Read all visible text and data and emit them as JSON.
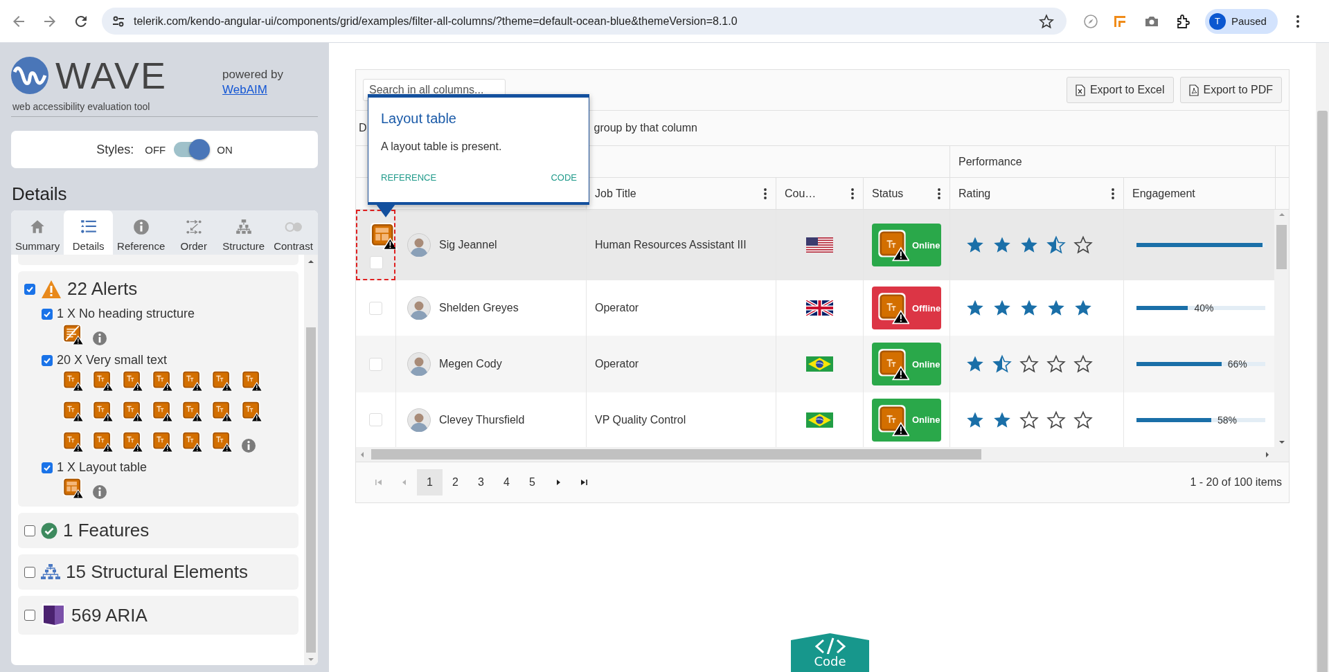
{
  "browser": {
    "url": "telerik.com/kendo-angular-ui/components/grid/examples/filter-all-columns/?theme=default-ocean-blue&themeVersion=8.1.0",
    "profile_initial": "T",
    "profile_status": "Paused"
  },
  "wave": {
    "logo_text": "WAVE",
    "tagline": "web accessibility evaluation tool",
    "powered_by": "powered by",
    "powered_link": "WebAIM",
    "styles": {
      "label": "Styles:",
      "off": "OFF",
      "on": "ON",
      "enabled": true
    },
    "heading": "Details",
    "tabs": [
      {
        "label": "Summary",
        "selected": false
      },
      {
        "label": "Details",
        "selected": true
      },
      {
        "label": "Reference",
        "selected": false
      },
      {
        "label": "Order",
        "selected": false
      },
      {
        "label": "Structure",
        "selected": false
      },
      {
        "label": "Contrast",
        "selected": false
      }
    ],
    "categories": [
      {
        "kind": "alerts",
        "label": "22 Alerts",
        "checked": true,
        "items": [
          {
            "label": "1 X No heading structure",
            "checked": true,
            "icons": [
              {
                "kind": "heading"
              }
            ]
          },
          {
            "label": "20 X Very small text",
            "checked": true,
            "icons": [
              {
                "kind": "small-text"
              },
              {
                "kind": "small-text"
              },
              {
                "kind": "small-text"
              },
              {
                "kind": "small-text"
              },
              {
                "kind": "small-text"
              },
              {
                "kind": "small-text"
              },
              {
                "kind": "small-text"
              },
              {
                "kind": "small-text"
              },
              {
                "kind": "small-text"
              },
              {
                "kind": "small-text"
              },
              {
                "kind": "small-text"
              },
              {
                "kind": "small-text"
              },
              {
                "kind": "small-text"
              },
              {
                "kind": "small-text"
              },
              {
                "kind": "small-text"
              },
              {
                "kind": "small-text"
              },
              {
                "kind": "small-text"
              },
              {
                "kind": "small-text"
              },
              {
                "kind": "small-text"
              },
              {
                "kind": "small-text"
              }
            ]
          },
          {
            "label": "1 X Layout table",
            "checked": true,
            "icons": [
              {
                "kind": "layout-table"
              }
            ]
          }
        ]
      },
      {
        "kind": "features",
        "label": "1 Features",
        "checked": false
      },
      {
        "kind": "structure",
        "label": "15 Structural Elements",
        "checked": false
      },
      {
        "kind": "aria",
        "label": "569 ARIA",
        "checked": false
      }
    ]
  },
  "grid": {
    "search_placeholder": "Search in all columns...",
    "exports": [
      {
        "kind": "excel",
        "label": "Export to Excel"
      },
      {
        "kind": "pdf",
        "label": "Export to PDF"
      }
    ],
    "group_hint_start": "D",
    "group_hint_end": "group by that column",
    "header_group": "Performance",
    "columns": [
      "Job Title",
      "Cou…",
      "Status",
      "Rating",
      "Engagement"
    ],
    "rows": [
      {
        "name": "Sig Jeannel",
        "job": "Human Resources Assistant III",
        "flag": {
          "kind": "us"
        },
        "status": "Online",
        "online": true,
        "stars": 3.5,
        "level": 0.98,
        "hovered": true,
        "checked": false
      },
      {
        "name": "Shelden Greyes",
        "job": "Operator",
        "flag": {
          "kind": "gb"
        },
        "status": "Offline",
        "online": false,
        "stars": 5,
        "level": 0.4,
        "reading": "40%",
        "hovered": false,
        "checked": false
      },
      {
        "name": "Megen Cody",
        "job": "Operator",
        "flag": {
          "kind": "br"
        },
        "status": "Online",
        "online": true,
        "stars": 1.5,
        "level": 0.66,
        "reading": "66%",
        "hovered": false,
        "checked": false
      },
      {
        "name": "Clevey Thursfield",
        "job": "VP Quality Control",
        "flag": {
          "kind": "br"
        },
        "status": "Online",
        "online": true,
        "stars": 2,
        "level": 0.58,
        "reading": "58%",
        "hovered": false,
        "checked": false
      }
    ],
    "pager": {
      "nav": [
        {
          "kind": "first",
          "disabled": true
        },
        {
          "kind": "prev",
          "disabled": true
        },
        {
          "kind": "next",
          "disabled": false
        },
        {
          "kind": "last",
          "disabled": false
        }
      ],
      "pages": [
        {
          "label": "1",
          "selected": true
        },
        {
          "label": "2",
          "selected": false
        },
        {
          "label": "3",
          "selected": false
        },
        {
          "label": "4",
          "selected": false
        },
        {
          "label": "5",
          "selected": false
        }
      ],
      "summary": "1 - 20 of 100 items"
    }
  },
  "tooltip": {
    "title": "Layout table",
    "text": "A layout table is present.",
    "links": [
      "REFERENCE",
      "CODE"
    ]
  },
  "code_button": {
    "label": "Code"
  }
}
